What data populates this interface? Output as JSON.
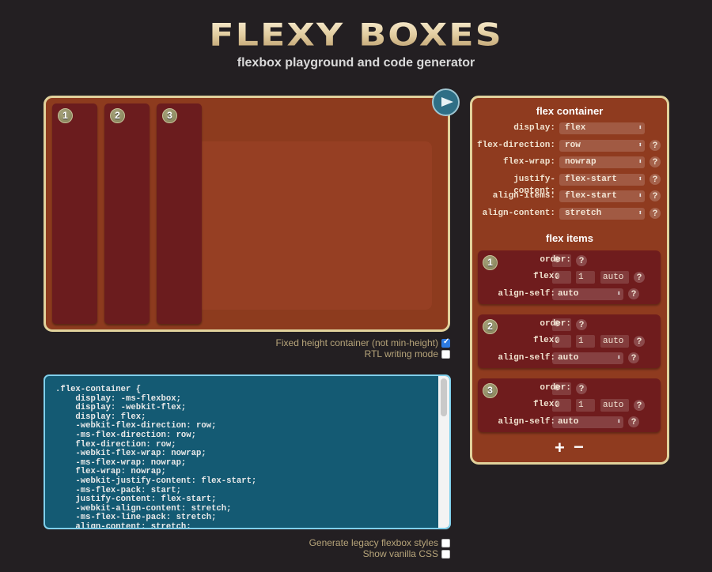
{
  "header": {
    "title": "FLEXY BOXES",
    "subtitle": "flexbox playground and code generator"
  },
  "playground": {
    "items": [
      "1",
      "2",
      "3"
    ],
    "play_icon": "play-icon"
  },
  "options": {
    "fixed_height": {
      "label": "Fixed height container (not min-height)",
      "checked": true
    },
    "rtl": {
      "label": "RTL writing mode",
      "checked": false
    },
    "legacy": {
      "label": "Generate legacy flexbox styles",
      "checked": false
    },
    "vanilla": {
      "label": "Show vanilla CSS",
      "checked": false
    }
  },
  "code": ".flex-container {\n    display: -ms-flexbox;\n    display: -webkit-flex;\n    display: flex;\n    -webkit-flex-direction: row;\n    -ms-flex-direction: row;\n    flex-direction: row;\n    -webkit-flex-wrap: nowrap;\n    -ms-flex-wrap: nowrap;\n    flex-wrap: nowrap;\n    -webkit-justify-content: flex-start;\n    -ms-flex-pack: start;\n    justify-content: flex-start;\n    -webkit-align-content: stretch;\n    -ms-flex-line-pack: stretch;\n    align-content: stretch;",
  "container": {
    "heading": "flex container",
    "rows": [
      {
        "label": "display:",
        "value": "flex"
      },
      {
        "label": "flex-direction:",
        "value": "row",
        "help": "?"
      },
      {
        "label": "flex-wrap:",
        "value": "nowrap",
        "help": "?"
      },
      {
        "label": "justify-content:",
        "value": "flex-start",
        "help": "?"
      },
      {
        "label": "align-items:",
        "value": "flex-start",
        "help": "?"
      },
      {
        "label": "align-content:",
        "value": "stretch",
        "help": "?"
      }
    ]
  },
  "items": {
    "heading": "flex items",
    "labels": {
      "order": "order:",
      "flex": "flex:",
      "align_self": "align-self:"
    },
    "help": "?",
    "list": [
      {
        "n": "1",
        "order": "0",
        "grow": "0",
        "shrink": "1",
        "basis": "auto",
        "align_self": "auto"
      },
      {
        "n": "2",
        "order": "0",
        "grow": "0",
        "shrink": "1",
        "basis": "auto",
        "align_self": "auto"
      },
      {
        "n": "3",
        "order": "0",
        "grow": "0",
        "shrink": "1",
        "basis": "auto",
        "align_self": "auto"
      }
    ],
    "add": "+",
    "remove": "−"
  }
}
